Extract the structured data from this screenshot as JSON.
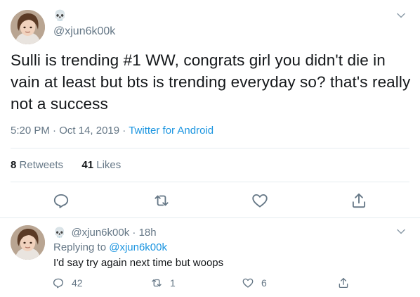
{
  "main_tweet": {
    "author_emoji": "💀",
    "handle": "@xjun6k00k",
    "text": "Sulli is trending #1 WW, congrats girl you didn't die in vain at least but bts is trending everyday so? that's really not a success",
    "time": "5:20 PM",
    "date": "Oct 14, 2019",
    "separator": "·",
    "source": "Twitter for Android",
    "retweets_count": "8",
    "retweets_label": "Retweets",
    "likes_count": "41",
    "likes_label": "Likes"
  },
  "reply_tweet": {
    "author_emoji": "💀",
    "handle": "@xjun6k00k",
    "age": "18h",
    "separator": "·",
    "replying_prefix": "Replying to",
    "replying_to": "@xjun6k00k",
    "text": "I'd say try again next time but woops",
    "reply_count": "42",
    "retweet_count": "1",
    "like_count": "6"
  },
  "colors": {
    "text": "#14171a",
    "secondary": "#657786",
    "link": "#1b95e0",
    "divider": "#e6ecf0"
  }
}
